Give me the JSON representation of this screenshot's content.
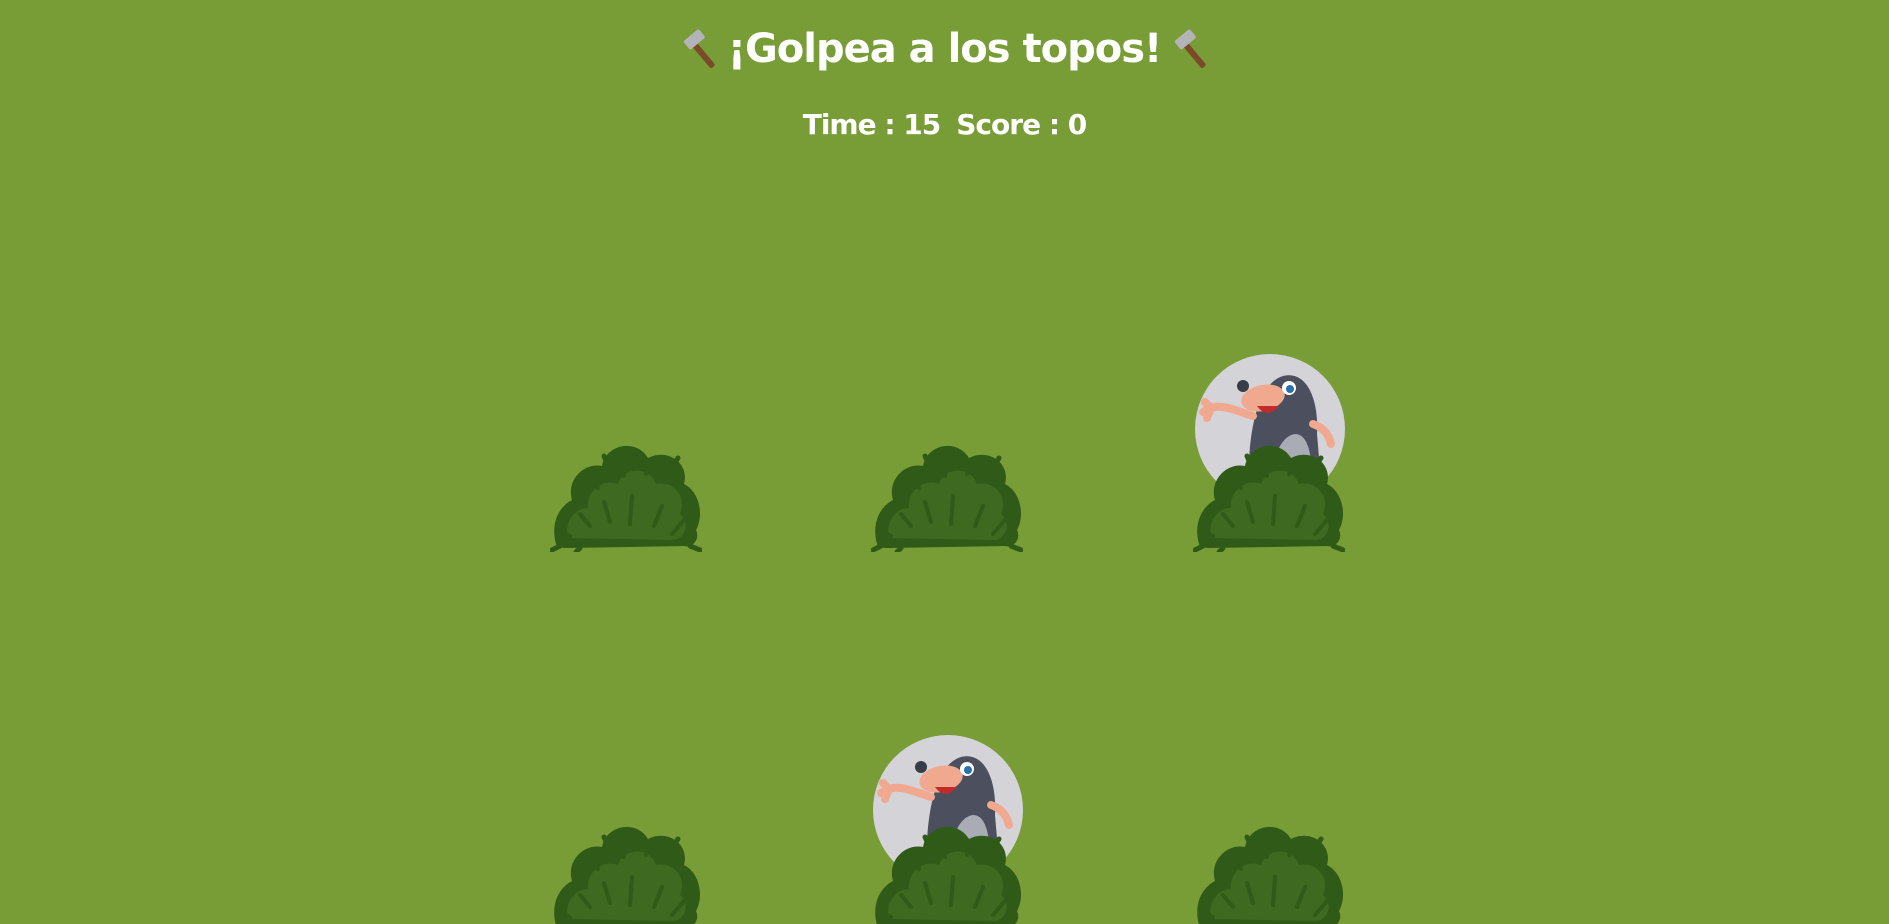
{
  "header": {
    "title": "¡Golpea a los topos!",
    "left_icon": "hammer-icon",
    "right_icon": "hammer-icon"
  },
  "stats": {
    "time_label": "Time : ",
    "time_value": "15",
    "score_label": "Score : ",
    "score_value": "0"
  },
  "board": {
    "rows": 2,
    "cols": 3,
    "holes": [
      {
        "id": 1,
        "mole_visible": false
      },
      {
        "id": 2,
        "mole_visible": false
      },
      {
        "id": 3,
        "mole_visible": true
      },
      {
        "id": 4,
        "mole_visible": false
      },
      {
        "id": 5,
        "mole_visible": true
      },
      {
        "id": 6,
        "mole_visible": false
      }
    ]
  },
  "colors": {
    "background": "#789d37",
    "text": "#ffffff",
    "bush_dark": "#2f5a18",
    "bush_mid": "#3f6c22",
    "mole_circle": "#d3d3d8",
    "mole_body": "#4b4f5e"
  }
}
